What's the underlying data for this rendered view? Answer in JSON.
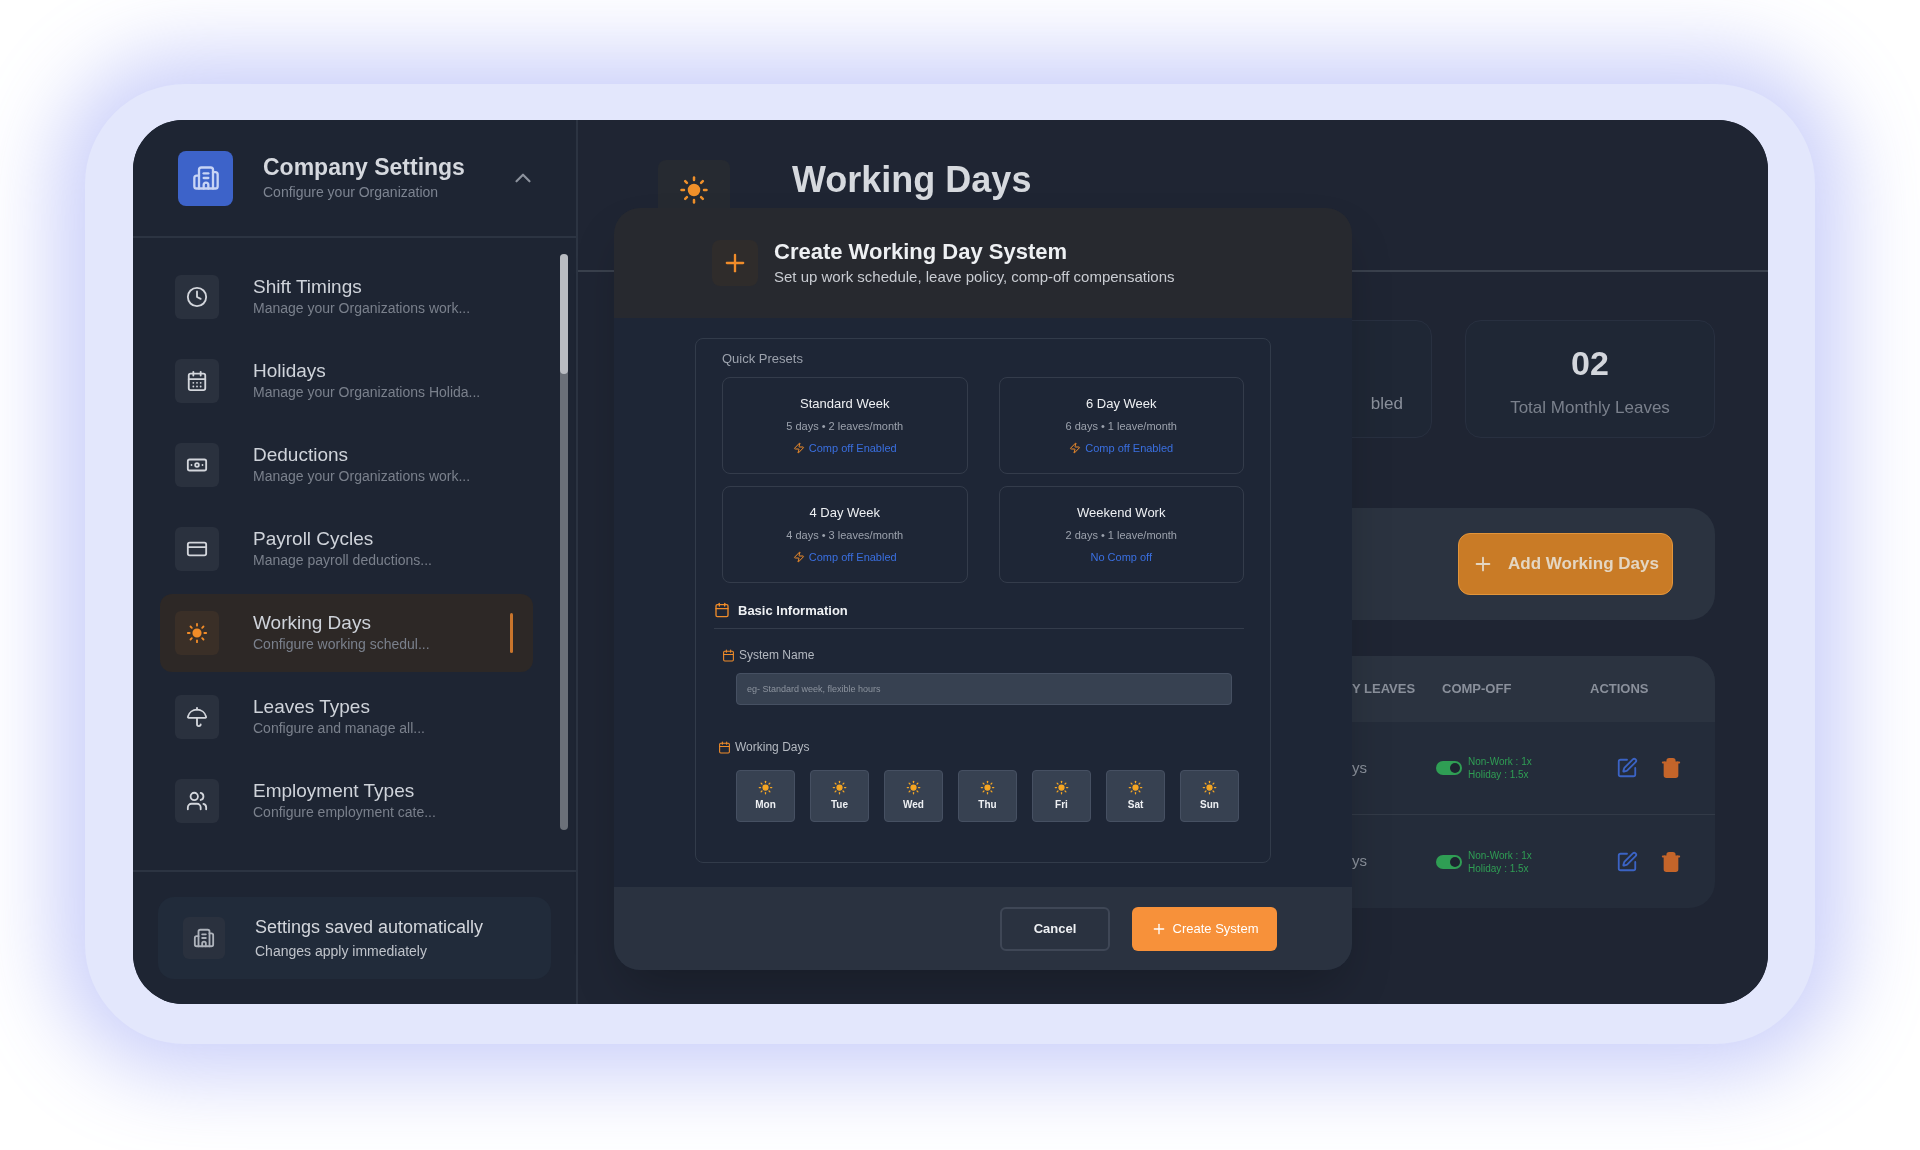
{
  "sidebar": {
    "title": "Company Settings",
    "subtitle": "Configure your Organization",
    "items": [
      {
        "label": "Shift Timings",
        "description": "Manage your Organizations work...",
        "selected": false
      },
      {
        "label": "Holidays",
        "description": "Manage your Organizations Holida...",
        "selected": false
      },
      {
        "label": "Deductions",
        "description": "Manage your Organizations work...",
        "selected": false
      },
      {
        "label": "Payroll Cycles",
        "description": "Manage payroll deductions...",
        "selected": false
      },
      {
        "label": "Working Days",
        "description": "Configure working schedul...",
        "selected": true
      },
      {
        "label": "Leaves Types",
        "description": "Configure and manage all...",
        "selected": false
      },
      {
        "label": "Employment Types",
        "description": "Configure employment cate...",
        "selected": false
      }
    ],
    "footer": {
      "title": "Settings saved automatically",
      "subtitle": "Changes apply immediately"
    }
  },
  "page": {
    "title": "Working Days",
    "stats": [
      {
        "label": "bled"
      },
      {
        "value": "02",
        "label": "Total Monthly Leaves"
      }
    ],
    "add_button": "Add Working Days",
    "table": {
      "columns": [
        "Y LEAVES",
        "COMP-OFF",
        "ACTIONS"
      ],
      "rows": [
        {
          "cell": "ys",
          "comp_off_on": true,
          "comp_off_lines": [
            "Non-Work : 1x",
            "Holiday : 1.5x"
          ]
        },
        {
          "cell": "ys",
          "comp_off_on": true,
          "comp_off_lines": [
            "Non-Work : 1x",
            "Holiday : 1.5x"
          ]
        }
      ]
    }
  },
  "modal": {
    "title": "Create Working Day System",
    "subtitle": "Set up work schedule, leave policy, comp-off compensations",
    "presets_title": "Quick Presets",
    "presets": [
      {
        "name": "Standard Week",
        "detail": "5 days • 2 leaves/month",
        "comp_off": "Comp off Enabled",
        "comp_off_enabled": true
      },
      {
        "name": "6 Day Week",
        "detail": "6 days • 1 leave/month",
        "comp_off": "Comp off Enabled",
        "comp_off_enabled": true
      },
      {
        "name": "4 Day Week",
        "detail": "4 days • 3 leaves/month",
        "comp_off": "Comp off Enabled",
        "comp_off_enabled": true
      },
      {
        "name": "Weekend Work",
        "detail": "2 days • 1 leave/month",
        "comp_off": "No Comp off",
        "comp_off_enabled": false
      }
    ],
    "section_title": "Basic Information",
    "system_name": {
      "label": "System Name",
      "placeholder": "eg- Standard week, flexible hours"
    },
    "working_days_label": "Working Days",
    "days": [
      "Mon",
      "Tue",
      "Wed",
      "Thu",
      "Fri",
      "Sat",
      "Sun"
    ],
    "buttons": {
      "cancel": "Cancel",
      "create": "Create System"
    }
  }
}
